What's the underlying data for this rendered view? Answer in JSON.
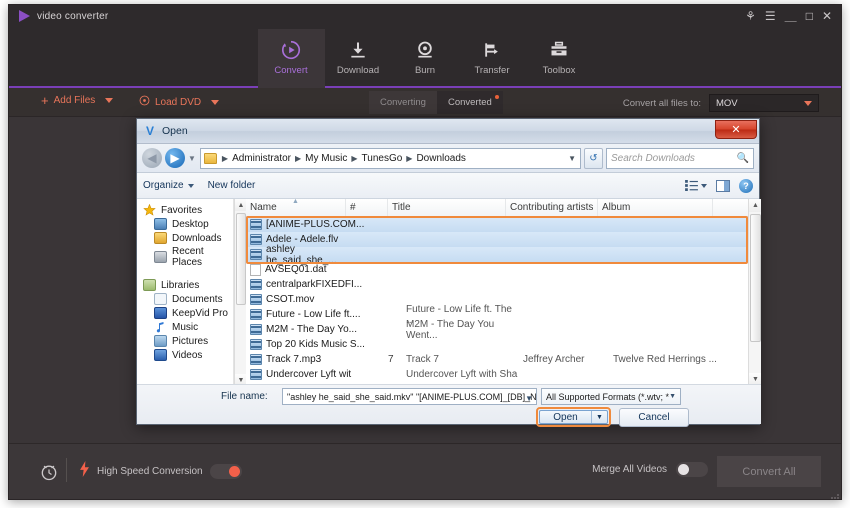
{
  "app": {
    "brand": "video converter",
    "window_controls": [
      {
        "name": "account-icon",
        "glyph": "⚘"
      },
      {
        "name": "menu-icon",
        "glyph": "☰"
      },
      {
        "name": "minimize-icon",
        "glyph": "＿"
      },
      {
        "name": "maximize-icon",
        "glyph": "□"
      },
      {
        "name": "close-icon",
        "glyph": "✕"
      }
    ],
    "nav": [
      {
        "label": "Convert",
        "icon": "convert-icon",
        "active": true
      },
      {
        "label": "Download",
        "icon": "download-icon",
        "active": false
      },
      {
        "label": "Burn",
        "icon": "burn-icon",
        "active": false
      },
      {
        "label": "Transfer",
        "icon": "transfer-icon",
        "active": false
      },
      {
        "label": "Toolbox",
        "icon": "toolbox-icon",
        "active": false
      }
    ],
    "toolbar": {
      "add_files": "Add Files",
      "load_dvd": "Load DVD",
      "tab_converting": "Converting",
      "tab_converted": "Converted",
      "convert_all_files_to": "Convert all files to:",
      "format_value": "MOV"
    },
    "bottom": {
      "high_speed_conversion": "High Speed Conversion",
      "high_speed_state": "on",
      "merge_all_videos": "Merge All Videos",
      "merge_state": "off",
      "convert_all": "Convert All"
    },
    "colors": {
      "accent_purple": "#7a3fb8",
      "accent_orange": "#e8755a",
      "toggle_on": "#f2604a",
      "window_bg": "#3a3537"
    }
  },
  "dialog": {
    "title": "Open",
    "close_glyph": "✕",
    "breadcrumbs": [
      "Administrator",
      "My Music",
      "TunesGo",
      "Downloads"
    ],
    "search_placeholder": "Search Downloads",
    "commands": {
      "organize": "Organize",
      "new_folder": "New folder"
    },
    "sidebar": [
      {
        "label": "Favorites",
        "icon": "star-icon",
        "group": true,
        "color": "#f2b90c"
      },
      {
        "label": "Desktop",
        "icon": "desktop-icon",
        "group": false,
        "color": "#5f8ec4"
      },
      {
        "label": "Downloads",
        "icon": "downloads-folder-icon",
        "group": false,
        "color": "#e8b43c"
      },
      {
        "label": "Recent Places",
        "icon": "recent-places-icon",
        "group": false,
        "color": "#9aa6b4"
      },
      {
        "label": "Libraries",
        "icon": "libraries-icon",
        "group": true,
        "color": "#e0b84c"
      },
      {
        "label": "Documents",
        "icon": "documents-icon",
        "group": false,
        "color": "#c9d6e4"
      },
      {
        "label": "KeepVid Pro",
        "icon": "keepvid-pro-icon",
        "group": false,
        "color": "#3b6fc4"
      },
      {
        "label": "Music",
        "icon": "music-icon",
        "group": false,
        "color": "#3b7fd4"
      },
      {
        "label": "Pictures",
        "icon": "pictures-icon",
        "group": false,
        "color": "#7fa8c8"
      },
      {
        "label": "Videos",
        "icon": "videos-icon",
        "group": false,
        "color": "#3b6fc4"
      }
    ],
    "columns": [
      "Name",
      "#",
      "Title",
      "Contributing artists",
      "Album"
    ],
    "files": [
      {
        "name": "[ANIME-PLUS.COM...",
        "num": "",
        "title": "",
        "artist": "",
        "album": "",
        "selected": true,
        "icon": "video-file-icon"
      },
      {
        "name": "Adele - Adele.flv",
        "num": "",
        "title": "",
        "artist": "",
        "album": "",
        "selected": true,
        "icon": "video-file-icon"
      },
      {
        "name": "ashley he_said_she_...",
        "num": "",
        "title": "",
        "artist": "",
        "album": "",
        "selected": true,
        "icon": "video-file-icon"
      },
      {
        "name": "AVSEQ01.dat",
        "num": "",
        "title": "",
        "artist": "",
        "album": "",
        "selected": false,
        "icon": "generic-file-icon"
      },
      {
        "name": "centralparkFIXEDFI...",
        "num": "",
        "title": "",
        "artist": "",
        "album": "",
        "selected": false,
        "icon": "video-file-icon"
      },
      {
        "name": "CSOT.mov",
        "num": "",
        "title": "",
        "artist": "",
        "album": "",
        "selected": false,
        "icon": "video-file-icon"
      },
      {
        "name": "Future - Low Life ft....",
        "num": "",
        "title": "Future - Low Life ft. The ...",
        "artist": "",
        "album": "",
        "selected": false,
        "icon": "video-file-icon"
      },
      {
        "name": "M2M - The Day Yo...",
        "num": "",
        "title": "M2M - The Day You Went...",
        "artist": "",
        "album": "",
        "selected": false,
        "icon": "video-file-icon"
      },
      {
        "name": "Top 20 Kids Music S...",
        "num": "",
        "title": "",
        "artist": "",
        "album": "",
        "selected": false,
        "icon": "video-file-icon"
      },
      {
        "name": "Track 7.mp3",
        "num": "7",
        "title": "Track 7",
        "artist": "Jeffrey Archer",
        "album": "Twelve Red Herrings ...",
        "selected": false,
        "icon": "video-file-icon"
      },
      {
        "name": "Undercover Lyft wit",
        "num": "",
        "title": "Undercover Lyft with Sha",
        "artist": "",
        "album": "",
        "selected": false,
        "icon": "video-file-icon"
      }
    ],
    "footer": {
      "file_name_label": "File name:",
      "file_name_value": "\"ashley he_said_she_said.mkv\" \"[ANIME-PLUS.COM]_[DB]_Naruto_Shippuuden_Mo",
      "filter_value": "All Supported Formats (*.wtv; *",
      "open_button": "Open",
      "cancel_button": "Cancel"
    }
  }
}
